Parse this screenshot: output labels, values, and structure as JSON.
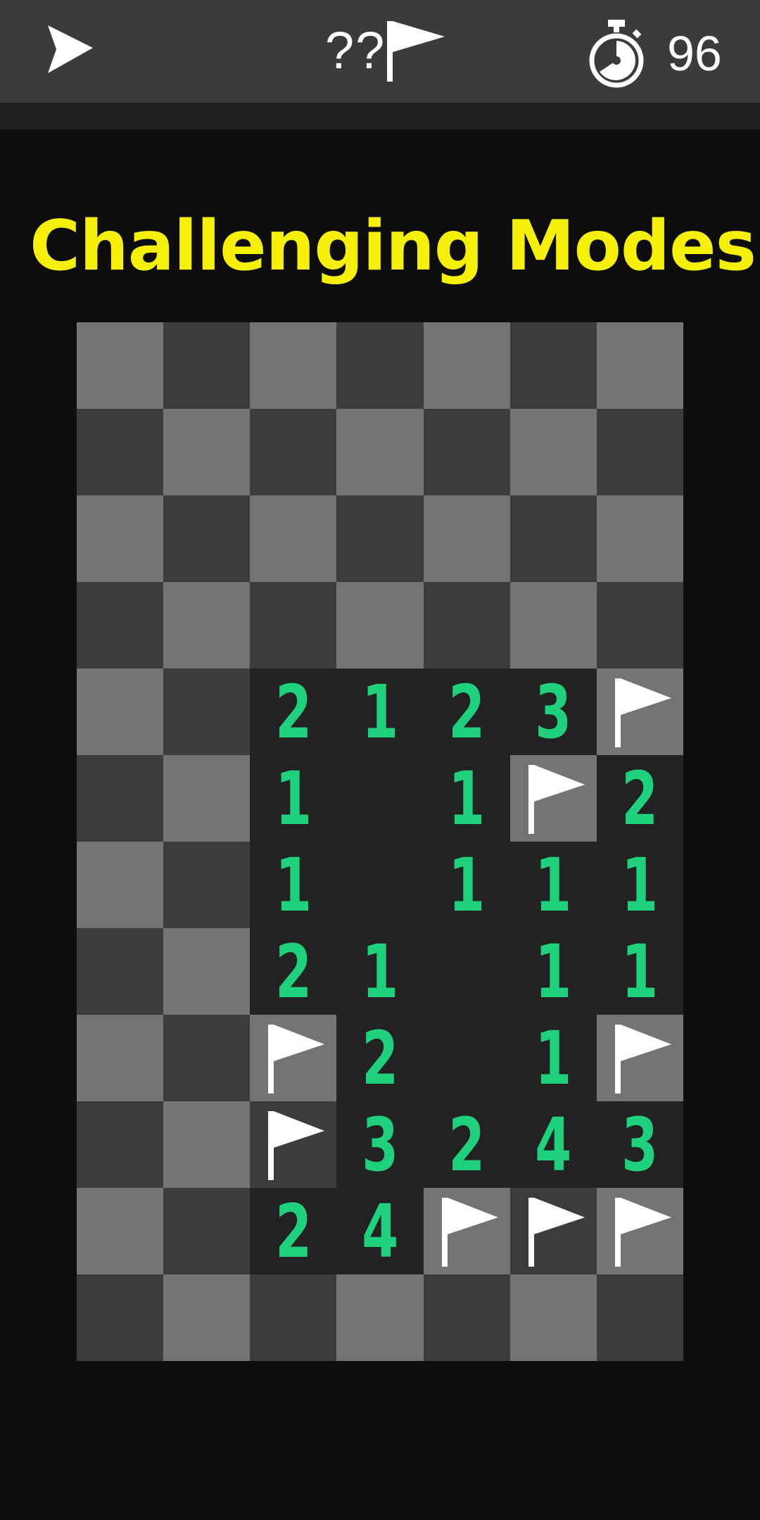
{
  "header": {
    "flag_count": "??",
    "timer": "96",
    "icons": {
      "play": "play-icon",
      "flag": "flag-icon",
      "timer": "stopwatch-icon"
    }
  },
  "title": "Challenging Modes",
  "colors": {
    "title": "#f5ef0a",
    "number": "#1fd17c",
    "tile_light": "#747474",
    "tile_dark": "#3c3c3c",
    "tile_open": "#222222",
    "flag": "#ffffff"
  },
  "board": {
    "cols": 7,
    "rows": 12,
    "cells": [
      [
        "",
        "",
        "",
        "",
        "",
        "",
        ""
      ],
      [
        "",
        "",
        "",
        "",
        "",
        "",
        ""
      ],
      [
        "",
        "",
        "",
        "",
        "",
        "",
        ""
      ],
      [
        "",
        "",
        "",
        "",
        "",
        "",
        ""
      ],
      [
        "",
        "",
        "2",
        "1",
        "2",
        "3",
        "F"
      ],
      [
        "",
        "",
        "1",
        "0",
        "1",
        "F",
        "2"
      ],
      [
        "",
        "",
        "1",
        "0",
        "1",
        "1",
        "1"
      ],
      [
        "",
        "",
        "2",
        "1",
        "0",
        "1",
        "1"
      ],
      [
        "",
        "",
        "F",
        "2",
        "0",
        "1",
        "F"
      ],
      [
        "",
        "",
        "F",
        "3",
        "2",
        "4",
        "3"
      ],
      [
        "",
        "",
        "2",
        "4",
        "F",
        "F",
        "F"
      ],
      [
        "",
        "",
        "",
        "",
        "",
        "",
        ""
      ]
    ]
  }
}
